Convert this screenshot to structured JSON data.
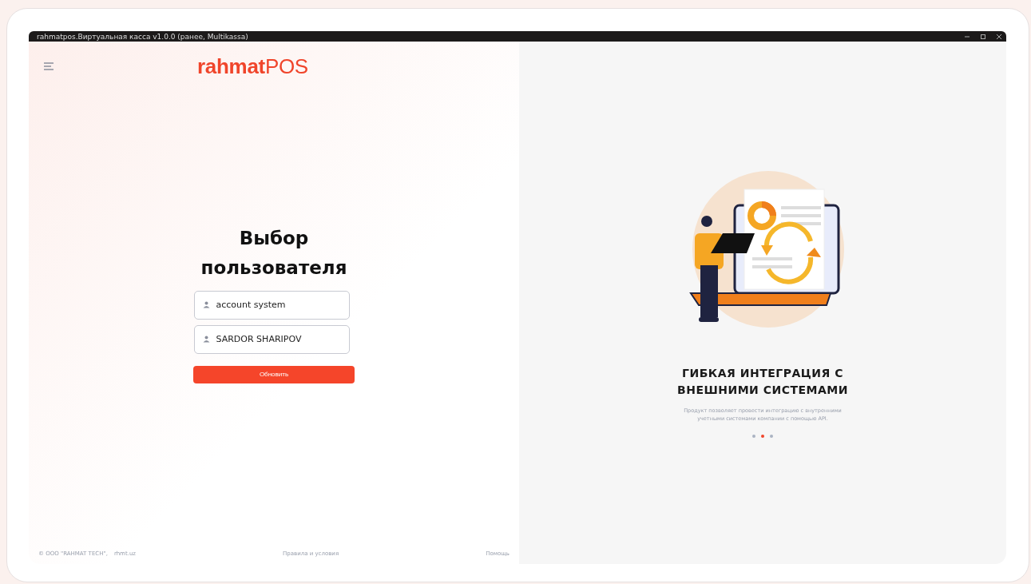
{
  "window": {
    "title": "rahmatpos.Виртуальная касса v1.0.0 (ранее, Multikassa)"
  },
  "logo": "**rahmat**POS",
  "heading": "Выбор пользователя",
  "users": [
    {
      "name": "account system"
    },
    {
      "name": "SARDOR SHARIPOV"
    }
  ],
  "refresh_button": "Обновить",
  "footer": {
    "copyright": "© ООО \"RAHMAT TECH\",",
    "site": "rhmt.uz",
    "terms": "Правила и условия",
    "help": "Помощь"
  },
  "slide": {
    "title": "ГИБКАЯ ИНТЕГРАЦИЯ С ВНЕШНИМИ СИСТЕМАМИ",
    "text": "Продукт позволяет провести интеграцию с внутренними учетными системами компании с помощью API."
  },
  "dots": [
    {
      "selected": false
    },
    {
      "selected": true
    },
    {
      "selected": false
    }
  ]
}
